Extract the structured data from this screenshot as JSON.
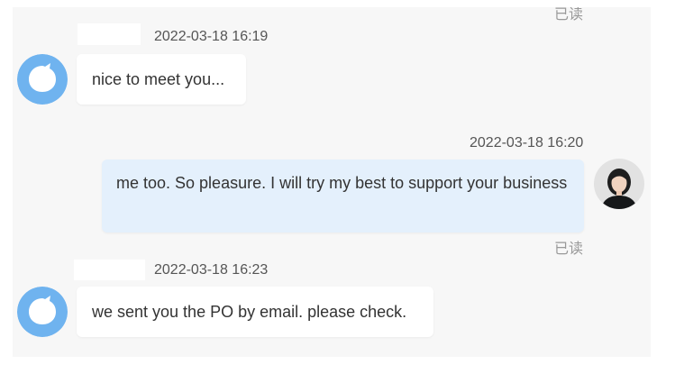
{
  "messages": [
    {
      "direction": "incoming",
      "timestamp": "2022-03-18 16:19",
      "text": "nice to meet you...",
      "avatar_icon": "chat-bubble-icon"
    },
    {
      "direction": "outgoing",
      "timestamp": "2022-03-18 16:20",
      "text": "me too. So pleasure. I will try my best to support your business",
      "status": "已读",
      "avatar_icon": "user-photo"
    },
    {
      "direction": "incoming",
      "timestamp": "2022-03-18 16:23",
      "text": "we sent you the PO by email. please check.",
      "avatar_icon": "chat-bubble-icon"
    }
  ],
  "top_status": "已读",
  "colors": {
    "panel_bg": "#f7f7f7",
    "incoming_bubble": "#ffffff",
    "outgoing_bubble": "#e4f0fc",
    "avatar_blue": "#6fb3ef",
    "status_text": "#999999"
  }
}
